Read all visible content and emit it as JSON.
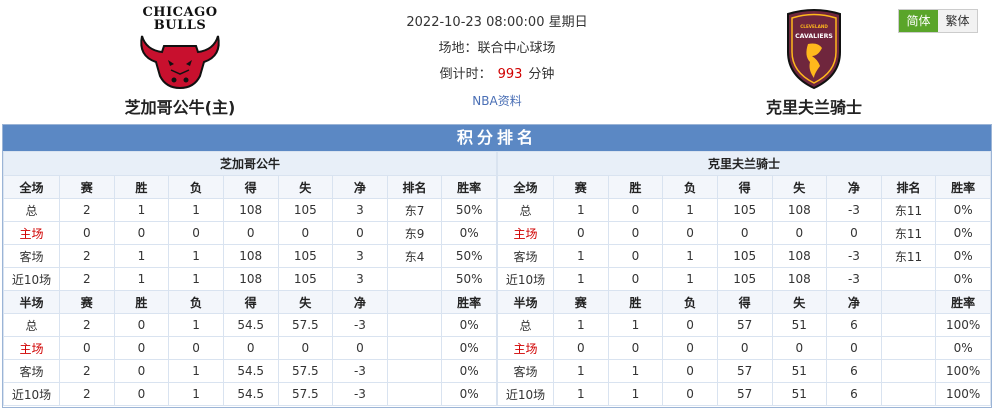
{
  "header": {
    "home": {
      "name": "芝加哥公牛(主)",
      "logo_text": [
        "CHICAGO",
        "BULLS"
      ],
      "logo_color": "#c8102e"
    },
    "away": {
      "name": "克里夫兰骑士",
      "logo_text": [
        "CLEVELAND",
        "CAVALIERS"
      ],
      "logo_color": "#6f263d"
    },
    "match": {
      "datetime": "2022-10-23 08:00:00 星期日",
      "venue_label": "场地：",
      "venue": "联合中心球场",
      "countdown_label": "倒计时：",
      "countdown_value": "993",
      "countdown_unit": "分钟",
      "info_link": "NBA资料"
    },
    "lang": {
      "simplified": "简体",
      "traditional": "繁体",
      "active_color": "#5aa52a"
    }
  },
  "standings": {
    "title": "积分排名",
    "accent": "#5b88c4",
    "home": {
      "team": "芝加哥公牛",
      "full_header": [
        "全场",
        "赛",
        "胜",
        "负",
        "得",
        "失",
        "净",
        "排名",
        "胜率"
      ],
      "full_rows": [
        {
          "label": "总",
          "red": false,
          "cells": [
            "2",
            "1",
            "1",
            "108",
            "105",
            "3",
            "东7",
            "50%"
          ]
        },
        {
          "label": "主场",
          "red": true,
          "cells": [
            "0",
            "0",
            "0",
            "0",
            "0",
            "0",
            "东9",
            "0%"
          ]
        },
        {
          "label": "客场",
          "red": false,
          "cells": [
            "2",
            "1",
            "1",
            "108",
            "105",
            "3",
            "东4",
            "50%"
          ]
        },
        {
          "label": "近10场",
          "red": false,
          "cells": [
            "2",
            "1",
            "1",
            "108",
            "105",
            "3",
            "",
            "50%"
          ]
        }
      ],
      "half_header": [
        "半场",
        "赛",
        "胜",
        "负",
        "得",
        "失",
        "净",
        "",
        "胜率"
      ],
      "half_rows": [
        {
          "label": "总",
          "red": false,
          "cells": [
            "2",
            "0",
            "1",
            "54.5",
            "57.5",
            "-3",
            "",
            "0%"
          ]
        },
        {
          "label": "主场",
          "red": true,
          "cells": [
            "0",
            "0",
            "0",
            "0",
            "0",
            "0",
            "",
            "0%"
          ]
        },
        {
          "label": "客场",
          "red": false,
          "cells": [
            "2",
            "0",
            "1",
            "54.5",
            "57.5",
            "-3",
            "",
            "0%"
          ]
        },
        {
          "label": "近10场",
          "red": false,
          "cells": [
            "2",
            "0",
            "1",
            "54.5",
            "57.5",
            "-3",
            "",
            "0%"
          ]
        }
      ]
    },
    "away": {
      "team": "克里夫兰骑士",
      "full_header": [
        "全场",
        "赛",
        "胜",
        "负",
        "得",
        "失",
        "净",
        "排名",
        "胜率"
      ],
      "full_rows": [
        {
          "label": "总",
          "red": false,
          "cells": [
            "1",
            "0",
            "1",
            "105",
            "108",
            "-3",
            "东11",
            "0%"
          ]
        },
        {
          "label": "主场",
          "red": true,
          "cells": [
            "0",
            "0",
            "0",
            "0",
            "0",
            "0",
            "东11",
            "0%"
          ]
        },
        {
          "label": "客场",
          "red": false,
          "cells": [
            "1",
            "0",
            "1",
            "105",
            "108",
            "-3",
            "东11",
            "0%"
          ]
        },
        {
          "label": "近10场",
          "red": false,
          "cells": [
            "1",
            "0",
            "1",
            "105",
            "108",
            "-3",
            "",
            "0%"
          ]
        }
      ],
      "half_header": [
        "半场",
        "赛",
        "胜",
        "负",
        "得",
        "失",
        "净",
        "",
        "胜率"
      ],
      "half_rows": [
        {
          "label": "总",
          "red": false,
          "cells": [
            "1",
            "1",
            "0",
            "57",
            "51",
            "6",
            "",
            "100%"
          ]
        },
        {
          "label": "主场",
          "red": true,
          "cells": [
            "0",
            "0",
            "0",
            "0",
            "0",
            "0",
            "",
            "0%"
          ]
        },
        {
          "label": "客场",
          "red": false,
          "cells": [
            "1",
            "1",
            "0",
            "57",
            "51",
            "6",
            "",
            "100%"
          ]
        },
        {
          "label": "近10场",
          "red": false,
          "cells": [
            "1",
            "1",
            "0",
            "57",
            "51",
            "6",
            "",
            "100%"
          ]
        }
      ]
    }
  }
}
